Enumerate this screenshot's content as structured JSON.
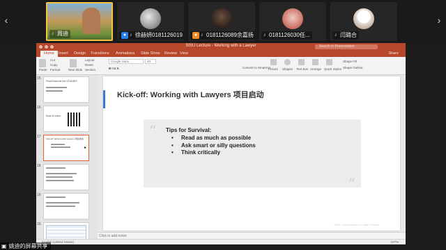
{
  "participants": [
    {
      "name": "周迪",
      "badge": "",
      "active": true
    },
    {
      "name": "徐赫妍0181126019",
      "badge": "user",
      "active": false
    },
    {
      "name": "0181126089余嘉扬",
      "badge": "user",
      "active": false
    },
    {
      "name": "0181126030任...",
      "badge": "",
      "active": false
    },
    {
      "name": "闫璐合",
      "badge": "",
      "active": false
    }
  ],
  "strip": {
    "prev": "‹",
    "next": "›"
  },
  "window": {
    "title": "SISU Lecture - Working with a Lawyer",
    "search_placeholder": "Search in Presentation",
    "share": "Share"
  },
  "menu": [
    "Home",
    "Insert",
    "Design",
    "Transitions",
    "Animations",
    "Slide Show",
    "Review",
    "View"
  ],
  "ribbon": {
    "paste": "Paste",
    "cut": "Cut",
    "copy": "Copy",
    "format": "Format",
    "new_slide": "New Slide",
    "layout": "Layout",
    "reset": "Reset",
    "section": "Section",
    "font": "Google Sans",
    "size": "40",
    "convert": "Convert to SmartArt",
    "picture": "Picture",
    "shapes": "Shapes",
    "text_box": "Text Box",
    "arrange": "Arrange",
    "quick_styles": "Quick Styles",
    "shape_fill": "Shape Fill",
    "shape_outline": "Shape Outline"
  },
  "slides": [
    {
      "num": "15"
    },
    {
      "num": "16"
    },
    {
      "num": "17"
    },
    {
      "num": "18"
    },
    {
      "num": "19"
    },
    {
      "num": "20"
    }
  ],
  "thumb_labels": {
    "s15": "Final Exam for the STUDIES",
    "s16": "Scan & notes",
    "s17": "Kick-off: Working with Lawyers 项目启动"
  },
  "slide": {
    "title": "Kick-off: Working with Lawyers 项目启动",
    "quote_open": "“",
    "quote_close": "”",
    "tips_heading": "Tips for Survival:",
    "bullets": [
      "Read as much as possible",
      "Ask smart or silly questions",
      "Think critically"
    ],
    "footer": "SISU - Introduction to Legal Practice"
  },
  "notes_placeholder": "Click to add notes",
  "status": {
    "text": "English (United States)",
    "zoom": "107%"
  },
  "share_banner": "姚迪的屏幕共享",
  "colors": {
    "accent": "#b7472a",
    "title_bar": "#3a78d6",
    "active_tile": "#f6c343"
  }
}
